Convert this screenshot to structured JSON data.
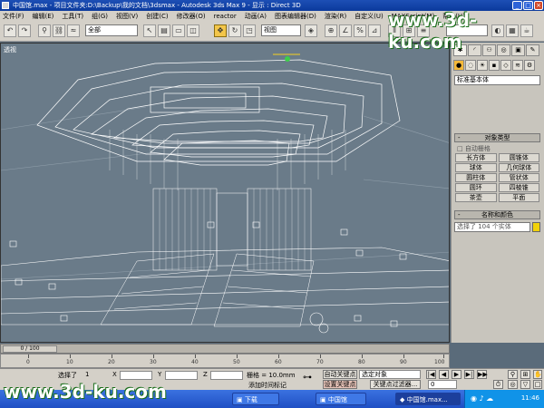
{
  "window": {
    "title": "中国馆.max - 项目文件夹:D:\\Backup\\我的文档\\3dsmax - Autodesk 3ds Max 9 - 显示 : Direct 3D",
    "buttons": [
      "minimize",
      "maximize",
      "close"
    ]
  },
  "menu": [
    "文件(F)",
    "编辑(E)",
    "工具(T)",
    "组(G)",
    "视图(V)",
    "创建(C)",
    "修改器(O)",
    "reactor",
    "动画(A)",
    "图表编辑器(D)",
    "渲染(R)",
    "自定义(U)",
    "MAXScript(M)",
    "帮助(H)"
  ],
  "toolbar": {
    "selection_filter": "全部",
    "coord_system": "视图"
  },
  "viewport": {
    "label": "透视",
    "bg_color": "#6a7b89",
    "wire_color": "#ffffff"
  },
  "command_panel": {
    "tabs": [
      "create",
      "modify",
      "hierarchy",
      "motion",
      "display",
      "utilities"
    ],
    "category_dropdown": "标准基本体",
    "rollout_object_type": "对象类型",
    "autogrid_label": "自动栅格",
    "primitives": [
      "长方体",
      "圆锥体",
      "球体",
      "几何球体",
      "圆柱体",
      "管状体",
      "圆环",
      "四棱锥",
      "茶壶",
      "平面"
    ],
    "rollout_name_color": "名称和颜色",
    "name_field": "选择了 104 个实体",
    "object_color": "#f2d20a"
  },
  "timeline": {
    "slider_text": "0 / 100",
    "ticks": [
      "0",
      "10",
      "20",
      "30",
      "40",
      "50",
      "60",
      "70",
      "80",
      "90",
      "100"
    ]
  },
  "status": {
    "selected_label": "选择了",
    "selected_count": "1",
    "x_label": "X",
    "y_label": "Y",
    "z_label": "Z",
    "grid_label": "栅格 = 10.0mm",
    "auto_key": "自动关键点",
    "set_key": "设置关键点",
    "key_filter": "关键点过滤器...",
    "selection_set": "选定对象",
    "add_time_tag": "添加时间标记",
    "frame": "0"
  },
  "taskbar": {
    "tasks": [
      "下载",
      "中国馆",
      "中国馆.max..."
    ],
    "clock": "11:46"
  },
  "watermark": {
    "top": "www.3d-ku.com",
    "bottom": "www.3d-ku.com"
  }
}
